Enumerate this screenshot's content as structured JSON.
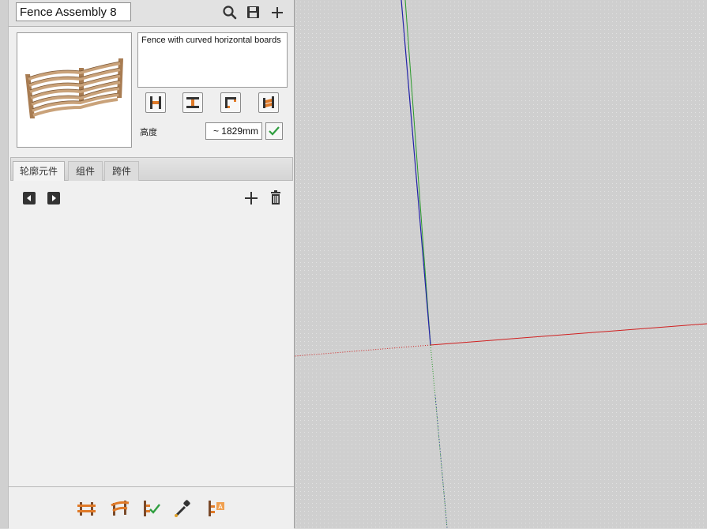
{
  "header": {
    "assembly_name": "Fence Assembly 8",
    "icons": [
      "search-icon",
      "save-icon",
      "add-icon"
    ]
  },
  "details": {
    "description": "Fence with curved horizontal boards",
    "height_label": "高度",
    "height_value": "~ 1829mm",
    "mode_icons": [
      "post-end-icon",
      "post-middle-icon",
      "corner-icon",
      "panel-icon"
    ]
  },
  "tabs": [
    {
      "label": "轮廓元件",
      "active": true
    },
    {
      "label": "组件",
      "active": false
    },
    {
      "label": "跨件",
      "active": false
    }
  ],
  "profile_toolbar": {
    "icons": [
      "previous-icon",
      "next-icon",
      "add-icon",
      "trash-icon"
    ]
  },
  "bottom_toolbar": {
    "icons": [
      "fence-draw-icon",
      "fence-curve-icon",
      "fence-validate-icon",
      "eyedropper-icon",
      "fence-label-icon"
    ]
  },
  "colors": {
    "accent_orange": "#e07a28",
    "wood": "#c9a27a",
    "axis_red": "#d22",
    "axis_green": "#2a2",
    "axis_blue": "#22a"
  }
}
